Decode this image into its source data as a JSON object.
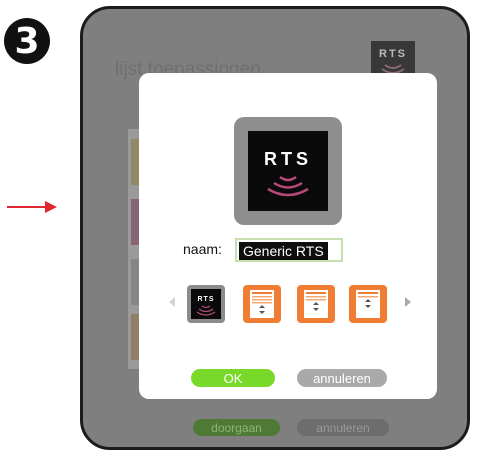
{
  "step_number": "3",
  "background_screen": {
    "title": "lijst toepassingen",
    "continue_label": "doorgaan",
    "cancel_label": "annuleren"
  },
  "dialog": {
    "app_icon_text": "RTS",
    "name_label": "naam:",
    "name_value": "Generic RTS",
    "icon_options": [
      "rts-icon",
      "blind-icon",
      "blind-icon",
      "blind-icon"
    ],
    "ok_label": "OK",
    "cancel_label": "annuleren"
  },
  "colors": {
    "ok": "#79d92a",
    "cancel": "#a9a9a9",
    "icon_orange": "#ef7e33",
    "arrow_red": "#e0262e"
  }
}
